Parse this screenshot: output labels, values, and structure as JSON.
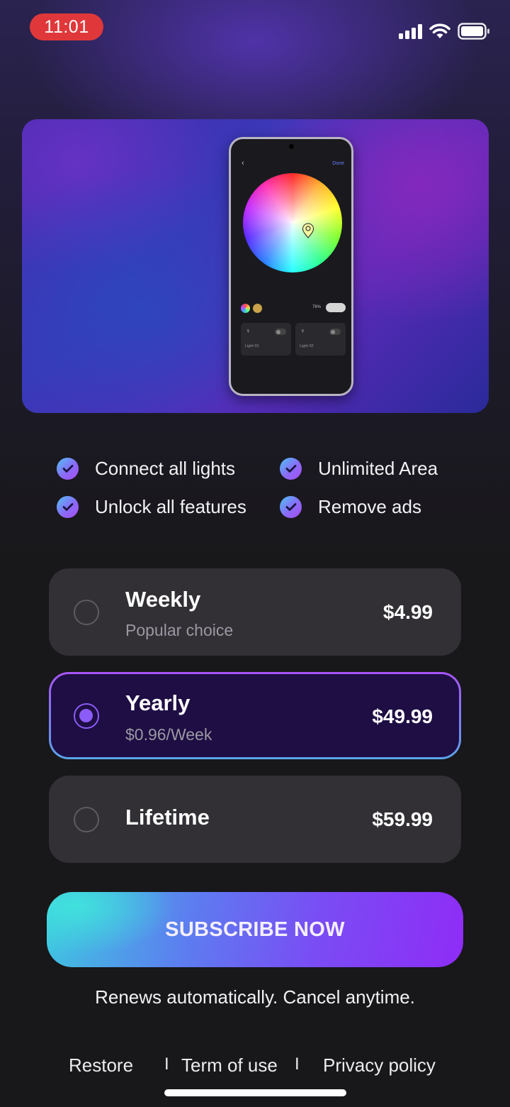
{
  "status_bar": {
    "time": "11:01",
    "time_pill_color": "#e0383a",
    "icons": [
      "signal-icon",
      "wifi-icon",
      "battery-icon"
    ]
  },
  "hero": {
    "phone_screen": {
      "done_label": "Done",
      "brightness": "76%",
      "cards": [
        {
          "label": "Light 01"
        },
        {
          "label": "Light 02"
        }
      ]
    }
  },
  "features": [
    {
      "label": "Connect all lights",
      "icon": "check-icon"
    },
    {
      "label": "Unlimited Area",
      "icon": "check-icon"
    },
    {
      "label": "Unlock all features",
      "icon": "check-icon"
    },
    {
      "label": "Remove ads",
      "icon": "check-icon"
    }
  ],
  "plans": [
    {
      "name": "Weekly",
      "subtitle": "Popular choice",
      "price": "$4.99",
      "selected": false
    },
    {
      "name": "Yearly",
      "subtitle": "$0.96/Week",
      "price": "$49.99",
      "selected": true
    },
    {
      "name": "Lifetime",
      "subtitle": "",
      "price": "$59.99",
      "selected": false
    }
  ],
  "subscribe_label": "SUBSCRIBE NOW",
  "renew_text": "Renews automatically. Cancel anytime.",
  "footer": {
    "restore": "Restore",
    "separator": "I",
    "terms": "Term of use",
    "privacy": "Privacy policy"
  },
  "colors": {
    "accent": "#8b5cf6",
    "background": "#181719",
    "card": "#323035",
    "selected_card": "#1e0e44"
  }
}
